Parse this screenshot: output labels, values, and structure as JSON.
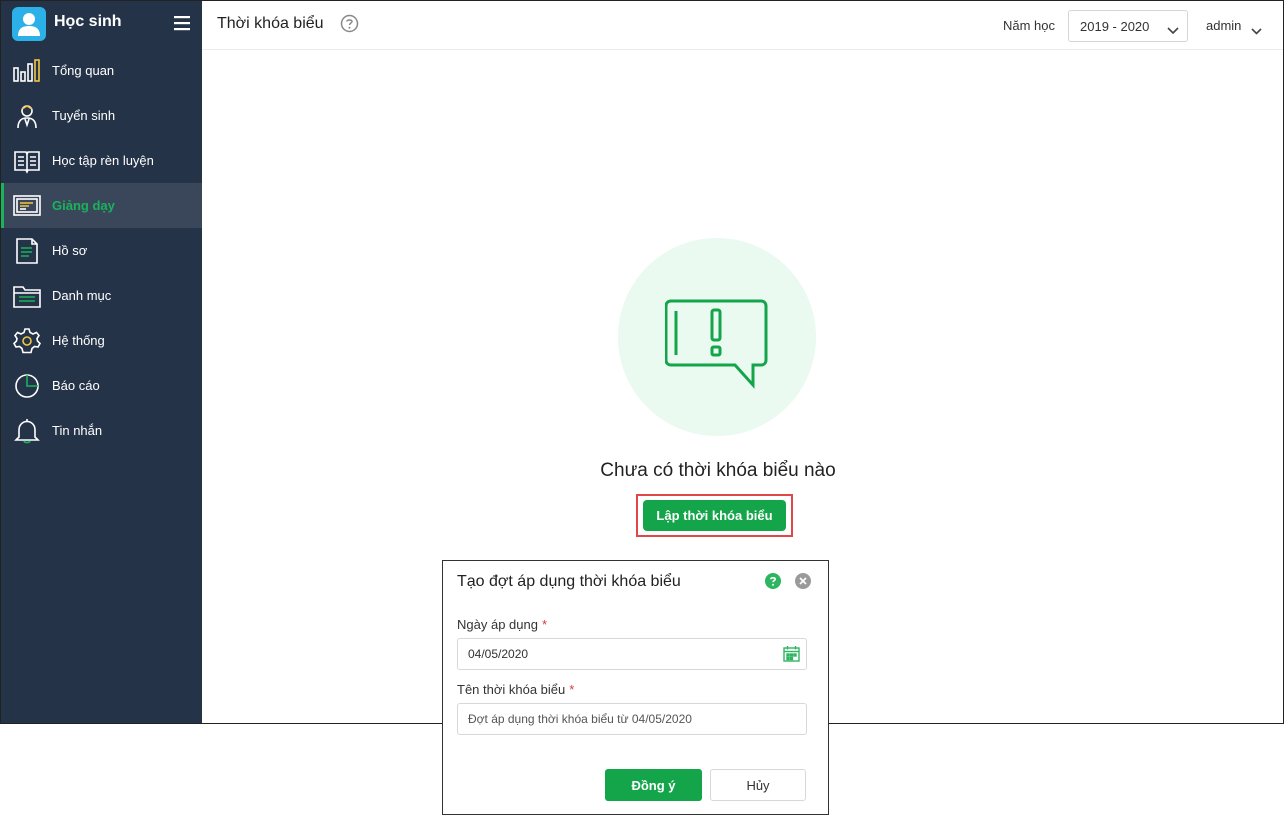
{
  "app": {
    "title": "Học sinh"
  },
  "sidebar": {
    "items": [
      {
        "label": "Tổng quan",
        "icon": "bar-chart-icon"
      },
      {
        "label": "Tuyển sinh",
        "icon": "student-icon"
      },
      {
        "label": "Học tập rèn luyện",
        "icon": "book-icon"
      },
      {
        "label": "Giảng dạy",
        "icon": "teaching-board-icon",
        "active": true
      },
      {
        "label": "Hồ sơ",
        "icon": "document-icon"
      },
      {
        "label": "Danh mục",
        "icon": "folder-icon"
      },
      {
        "label": "Hệ thống",
        "icon": "gear-icon"
      },
      {
        "label": "Báo cáo",
        "icon": "pie-chart-icon"
      },
      {
        "label": "Tin nhắn",
        "icon": "bell-icon"
      }
    ]
  },
  "header": {
    "title": "Thời khóa biểu",
    "year_label": "Năm học",
    "year_value": "2019 - 2020",
    "user": "admin"
  },
  "main": {
    "empty_message": "Chưa có thời khóa biểu nào",
    "create_button": "Lập thời khóa biểu"
  },
  "dialog": {
    "title": "Tạo đợt áp dụng thời khóa biểu",
    "date_label": "Ngày áp dụng",
    "date_value": "04/05/2020",
    "name_label": "Tên thời khóa biểu",
    "name_placeholder": "Đợt áp dụng thời khóa biểu từ 04/05/2020",
    "required_mark": "*",
    "ok_button": "Đồng ý",
    "cancel_button": "Hủy"
  },
  "colors": {
    "sidebar_bg": "#253348",
    "accent_green": "#14a54b",
    "active_green": "#19b35b",
    "icon_yellow": "#f2c744",
    "highlight_red": "#e04848",
    "empty_circle": "#eafaf0"
  }
}
